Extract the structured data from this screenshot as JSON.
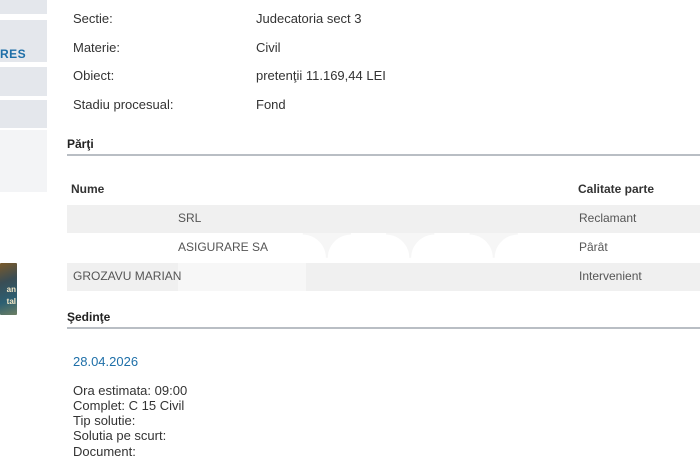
{
  "sidebar": {
    "item_text": "RES",
    "book_lines": [
      "an",
      "tal"
    ]
  },
  "info": [
    {
      "label": "Sectie:",
      "value": "Judecatoria sect 3"
    },
    {
      "label": "Materie:",
      "value": "Civil"
    },
    {
      "label": "Obiect:",
      "value": "pretenţii 11.169,44 LEI"
    },
    {
      "label": "Stadiu procesual:",
      "value": "Fond"
    }
  ],
  "parti": {
    "title": "Părţi",
    "headers": {
      "name": "Nume",
      "role": "Calitate parte"
    },
    "rows": [
      {
        "name": "SRL",
        "role": "Reclamant"
      },
      {
        "name": "ASIGURARE SA",
        "role": "Pârât"
      },
      {
        "name": "GROZAVU MARIAN",
        "role": "Intervenient"
      }
    ]
  },
  "sedinte": {
    "title": "Şedinţe",
    "date": "28.04.2026",
    "details": [
      "Ora estimata: 09:00",
      "Complet: C 15 Civil",
      "Tip solutie:",
      "Solutia pe scurt:",
      "Document:"
    ]
  }
}
